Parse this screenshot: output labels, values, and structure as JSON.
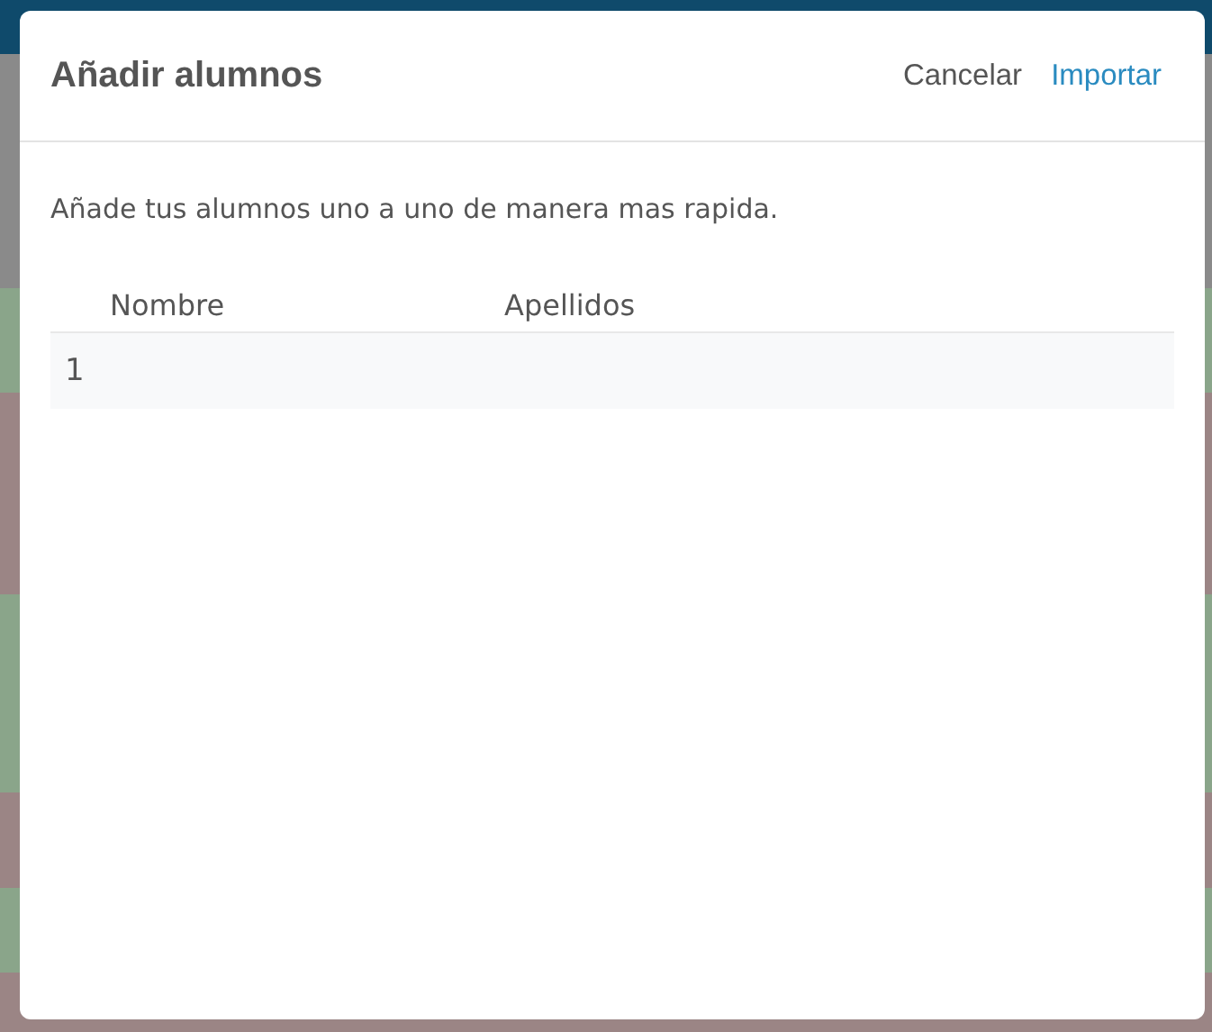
{
  "dialog": {
    "title": "Añadir alumnos",
    "buttons": [
      {
        "label": "Cancelar",
        "kind": "secondary"
      },
      {
        "label": "Importar",
        "kind": "primary"
      }
    ],
    "description": "Añade tus alumnos uno a uno de manera mas rapida.",
    "table": {
      "columns": [
        "Nombre",
        "Apellidos"
      ],
      "rows": [
        {
          "number": "1"
        }
      ]
    }
  }
}
